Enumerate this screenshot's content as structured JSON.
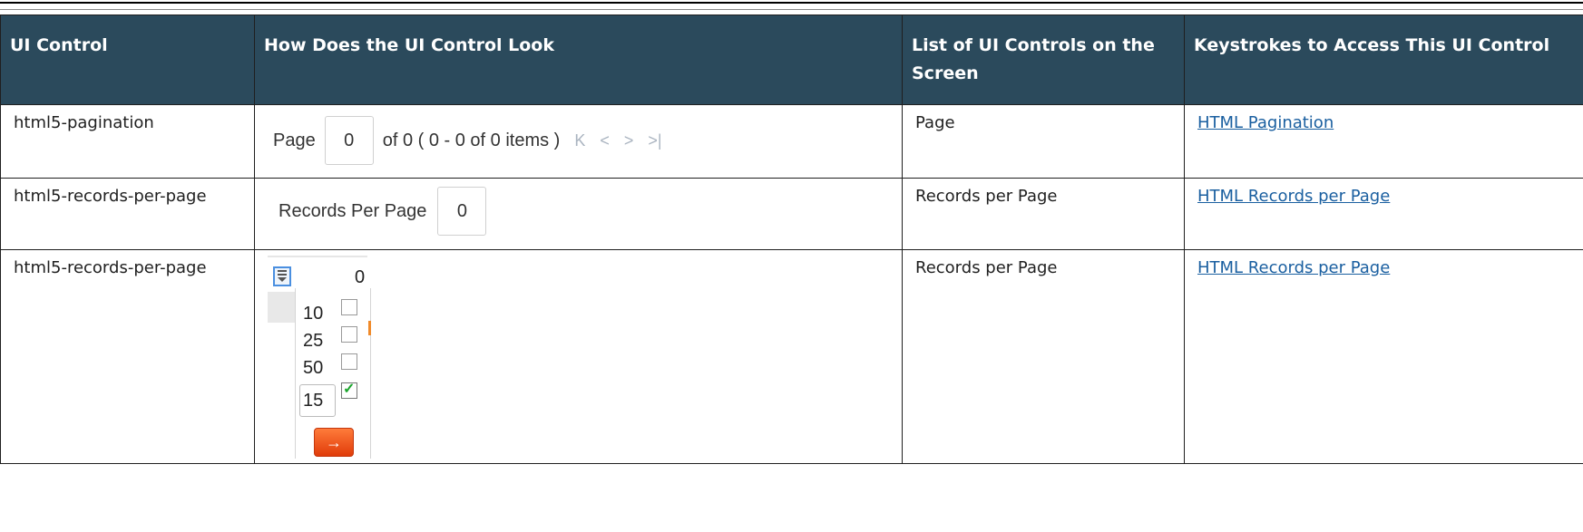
{
  "table": {
    "headers": [
      "UI Control",
      "How Does the UI Control Look",
      "List of UI Controls on the Screen",
      "Keystrokes to Access This UI Control"
    ],
    "rows": [
      {
        "control": "html5-pagination",
        "list": "Page",
        "link": "HTML Pagination"
      },
      {
        "control": "html5-records-per-page",
        "list": "Records per Page",
        "link": "HTML Records per Page"
      },
      {
        "control": "html5-records-per-page",
        "list": "Records per Page",
        "link": "HTML Records per Page"
      }
    ]
  },
  "pagination": {
    "page_label": "Page",
    "page_value": "0",
    "summary": "of 0 ( 0 - 0 of 0 items )",
    "icons": [
      "first-page-icon",
      "prev-page-icon",
      "next-page-icon",
      "last-page-icon"
    ]
  },
  "records_per_page": {
    "label": "Records Per Page",
    "value": "0"
  },
  "dropdown": {
    "current_value": "0",
    "options": [
      {
        "label": "10",
        "checked": false
      },
      {
        "label": "25",
        "checked": false
      },
      {
        "label": "50",
        "checked": false
      },
      {
        "label": "15",
        "checked": true
      }
    ],
    "go_icon": "arrow-right-icon",
    "accent_color": "#e85a1c"
  },
  "colors": {
    "header_bg": "#2b4a5c",
    "link": "#1a5fa0"
  }
}
